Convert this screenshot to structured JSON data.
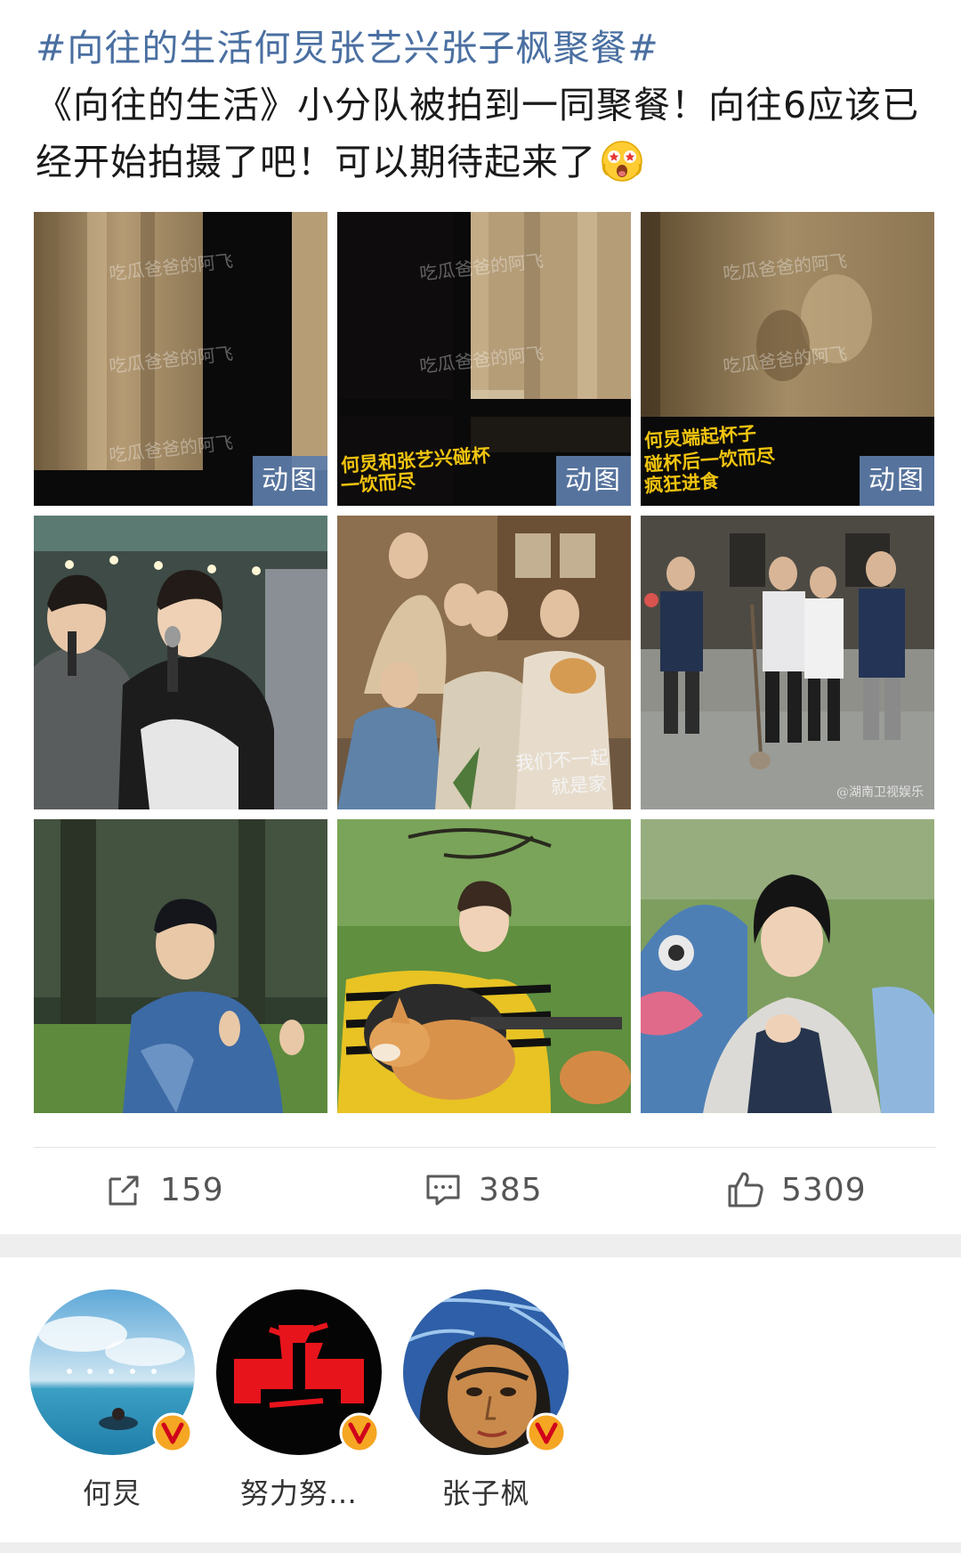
{
  "post": {
    "hashtag": "#向往的生活何炅张艺兴张子枫聚餐#",
    "body": "《向往的生活》小分队被拍到一同聚餐！向往6应该已经开始拍摄了吧！可以期待起来了",
    "emoji": "star-eyes-emoji"
  },
  "images": [
    {
      "label": "动图",
      "watermark": "吃瓜爸爸的阿飞",
      "caption_lines": []
    },
    {
      "label": "动图",
      "watermark": "吃瓜爸爸的阿飞",
      "caption_lines": [
        "何炅和张艺兴碰杯",
        "一饮而尽"
      ]
    },
    {
      "label": "动图",
      "watermark": "吃瓜爸爸的阿飞",
      "caption_lines": [
        "何炅端起杯子",
        "碰杯后一饮而尽",
        "疯狂进食"
      ]
    },
    {
      "label": "",
      "watermark": "",
      "caption_lines": []
    },
    {
      "label": "",
      "watermark": "",
      "caption_lines": [
        "我们不一起",
        "就是家"
      ]
    },
    {
      "label": "",
      "watermark": "@湖南卫视娱乐",
      "caption_lines": []
    },
    {
      "label": "",
      "watermark": "",
      "caption_lines": []
    },
    {
      "label": "",
      "watermark": "",
      "caption_lines": []
    },
    {
      "label": "",
      "watermark": "",
      "caption_lines": []
    }
  ],
  "actions": {
    "repost": {
      "icon": "share-icon",
      "count": "159"
    },
    "comment": {
      "icon": "comment-icon",
      "count": "385"
    },
    "like": {
      "icon": "thumbs-up-icon",
      "count": "5309"
    }
  },
  "mentioned_users": [
    {
      "name": "何炅",
      "verified": true
    },
    {
      "name": "努力努…",
      "verified": true
    },
    {
      "name": "张子枫",
      "verified": true
    }
  ],
  "colors": {
    "hashtag": "#4a6fa1",
    "gif_badge": "#5d7daa",
    "verified_badge": "#f5a623"
  }
}
